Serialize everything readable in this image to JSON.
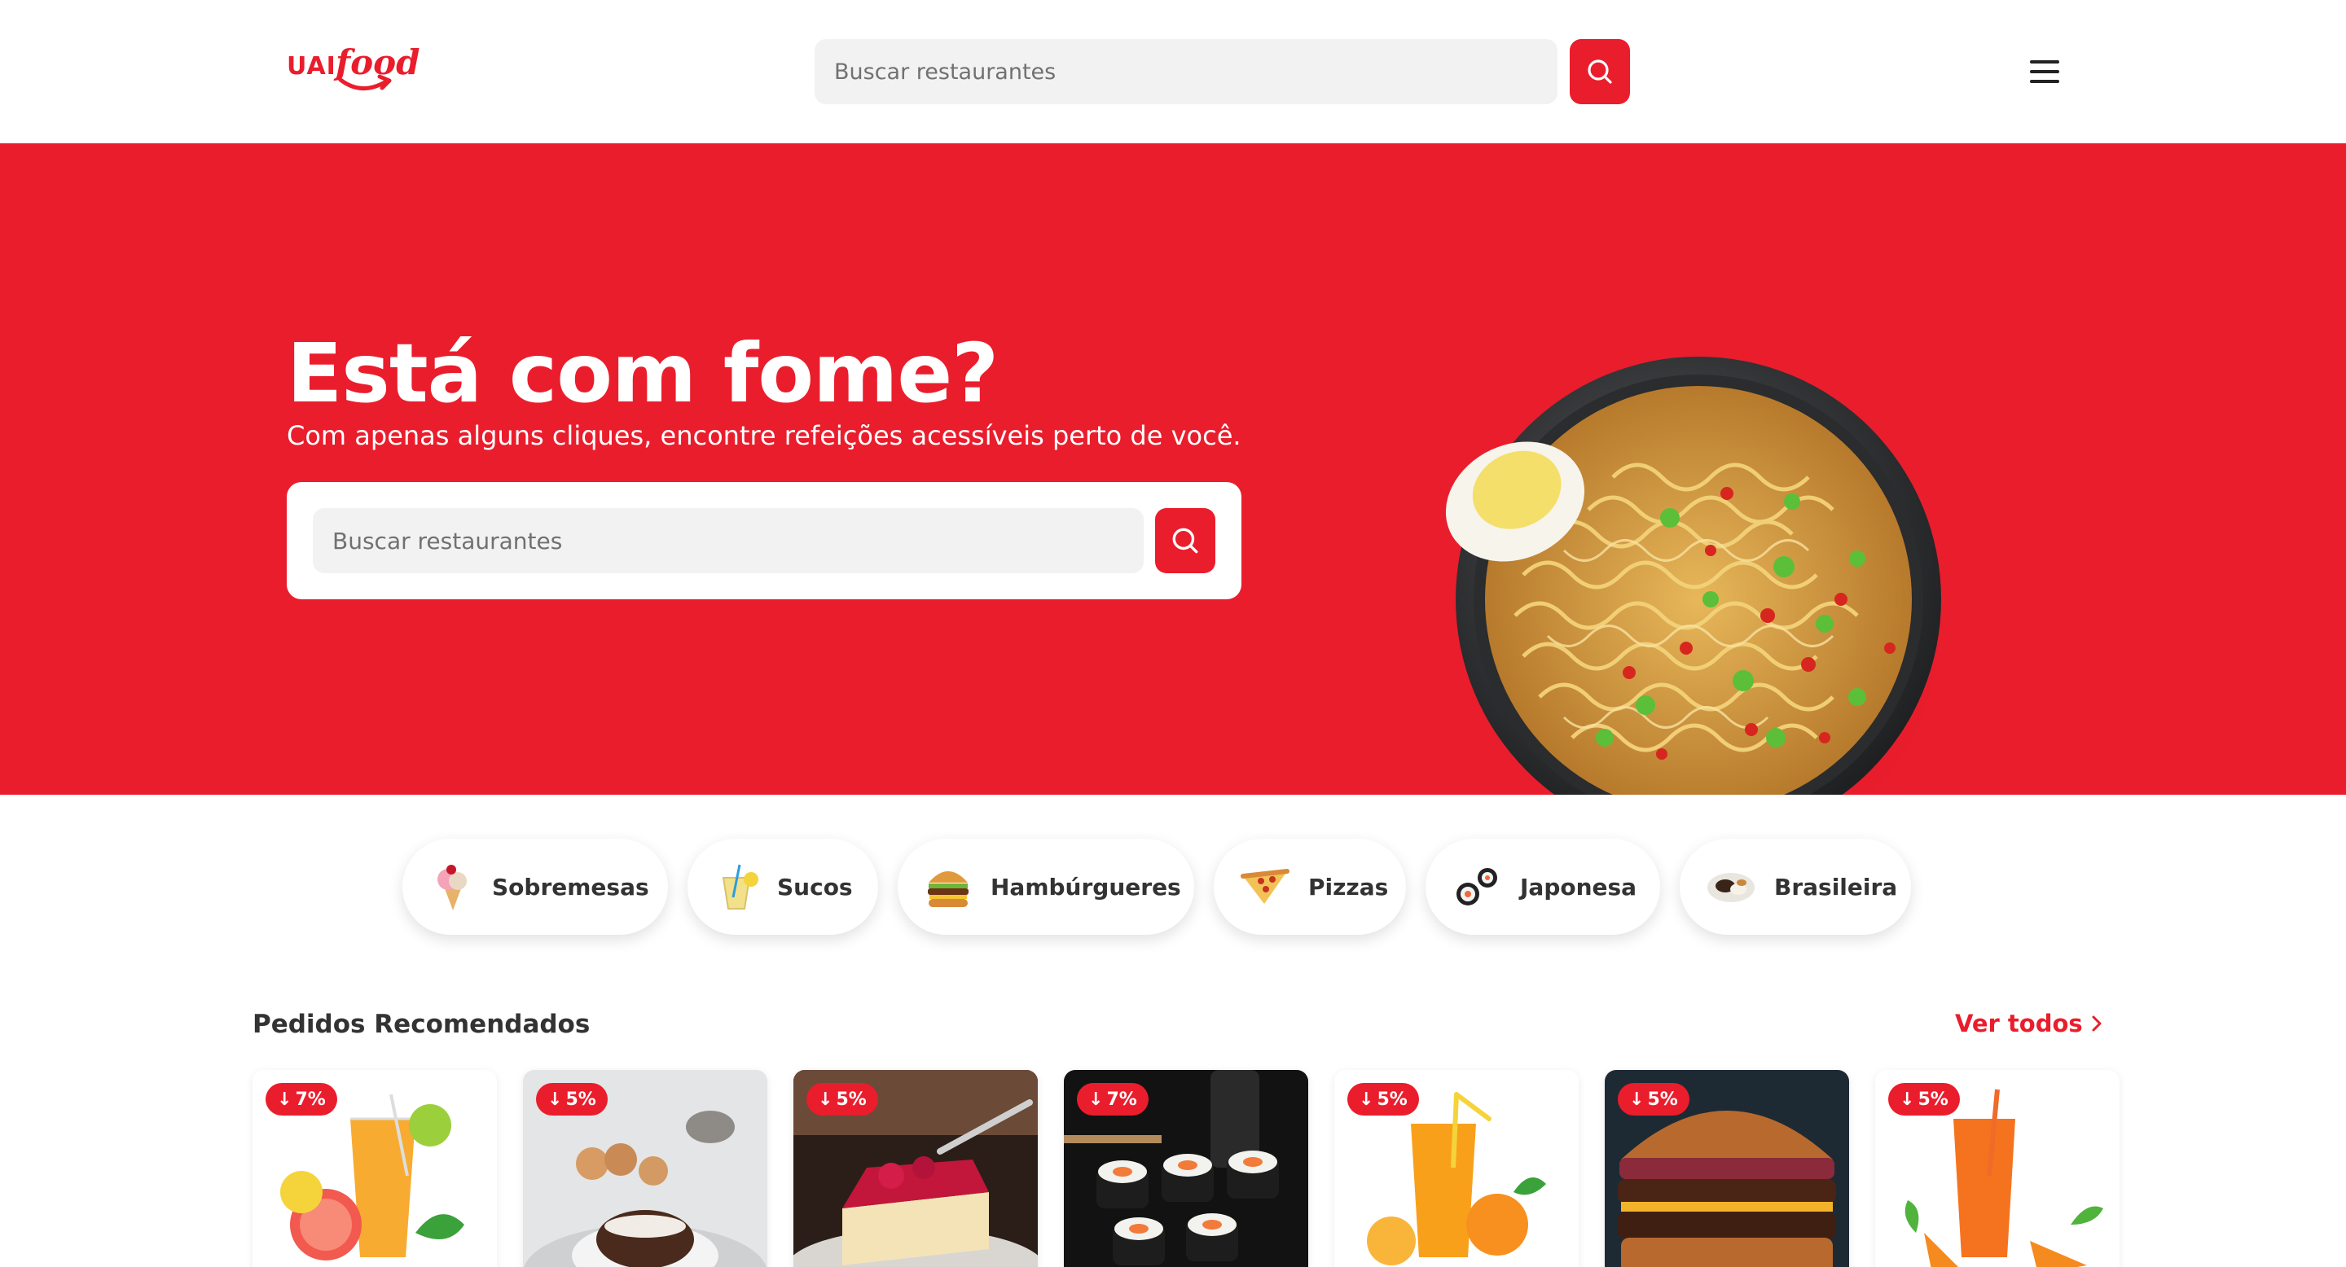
{
  "header": {
    "logo_text_uai": "UAI",
    "logo_text_food": "food",
    "search_placeholder": "Buscar restaurantes",
    "search_icon": "search-icon",
    "menu_icon": "hamburger-menu-icon"
  },
  "hero": {
    "title": "Está com fome?",
    "subtitle": "Com apenas alguns cliques, encontre refeições acessíveis perto de você.",
    "search_placeholder": "Buscar restaurantes",
    "search_icon": "search-icon",
    "image": "noodle-bowl-image"
  },
  "categories": [
    {
      "label": "Sobremesas",
      "icon": "ice-cream-icon"
    },
    {
      "label": "Sucos",
      "icon": "juice-icon"
    },
    {
      "label": "Hambúrgueres",
      "icon": "burger-icon"
    },
    {
      "label": "Pizzas",
      "icon": "pizza-icon"
    },
    {
      "label": "Japonesa",
      "icon": "sushi-icon"
    },
    {
      "label": "Brasileira",
      "icon": "feijoada-icon"
    }
  ],
  "recommended": {
    "title": "Pedidos Recomendados",
    "see_all": "Ver todos",
    "items": [
      {
        "discount": "7%",
        "image": "grapefruit-juice-image"
      },
      {
        "discount": "5%",
        "image": "chocolate-lava-cake-image"
      },
      {
        "discount": "5%",
        "image": "raspberry-cheesecake-image"
      },
      {
        "discount": "7%",
        "image": "sushi-rolls-image"
      },
      {
        "discount": "5%",
        "image": "orange-juice-image"
      },
      {
        "discount": "5%",
        "image": "double-burger-image"
      },
      {
        "discount": "5%",
        "image": "carrot-juice-image"
      }
    ]
  },
  "colors": {
    "brand": "#ea1d2c",
    "text": "#333333",
    "input_bg": "#f2f2f2"
  }
}
